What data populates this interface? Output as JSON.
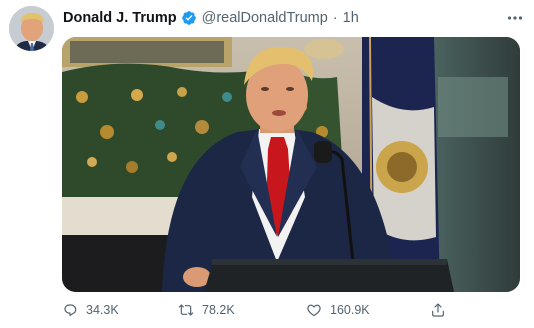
{
  "tweet": {
    "display_name": "Donald J. Trump",
    "handle": "@realDonaldTrump",
    "separator": "·",
    "time": "1h",
    "reply_count": "34.3K",
    "retweet_count": "78.2K",
    "like_count": "160.9K"
  },
  "colors": {
    "verified": "#1d9bf0",
    "text_primary": "#0f1419",
    "text_secondary": "#536471",
    "tie_red": "#c8161d",
    "suit_navy": "#1b2744"
  },
  "icons": [
    "verified-badge-icon",
    "more-icon",
    "reply-icon",
    "retweet-icon",
    "like-icon",
    "share-icon"
  ]
}
